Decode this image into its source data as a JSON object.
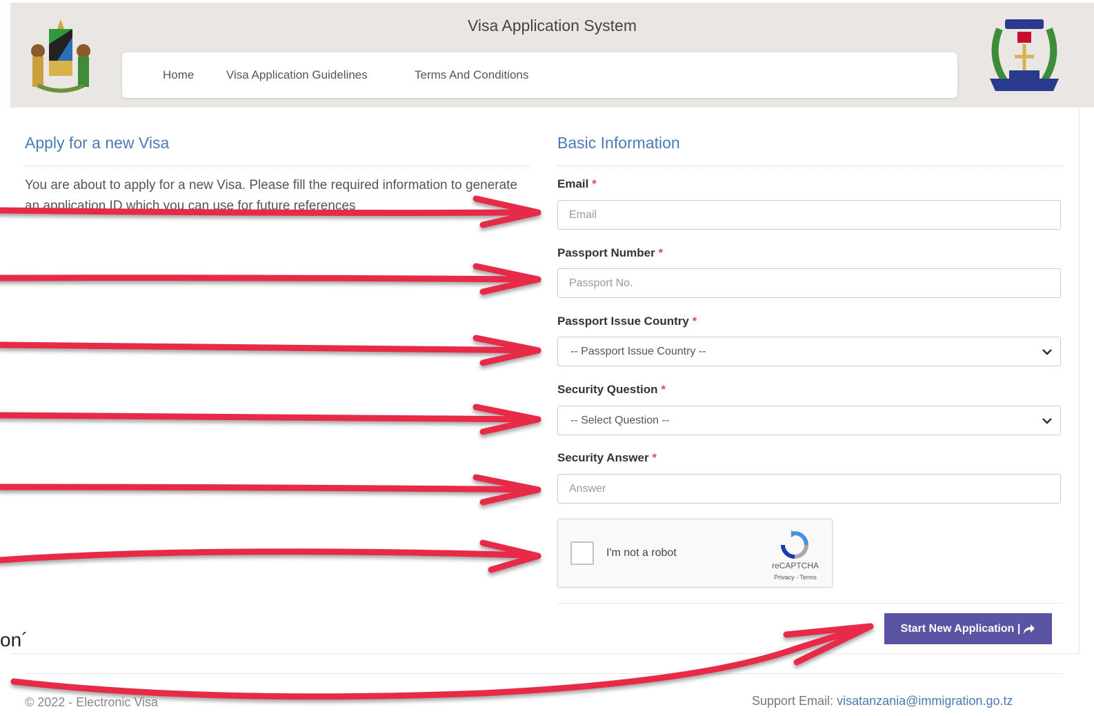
{
  "header": {
    "title": "Visa Application System",
    "nav": [
      "Home",
      "Visa Application Guidelines",
      "Terms And Conditions"
    ]
  },
  "left": {
    "title": "Apply for a new Visa",
    "intro": "You are about to apply for a new Visa. Please fill the required information to generate an application ID which you can use for future references"
  },
  "form": {
    "title": "Basic Information",
    "required_mark": "*",
    "email": {
      "label": "Email",
      "placeholder": "Email"
    },
    "passport": {
      "label": "Passport Number",
      "placeholder": "Passport No."
    },
    "country": {
      "label": "Passport Issue Country",
      "selected": "-- Passport Issue Country --"
    },
    "question": {
      "label": "Security Question",
      "selected": "-- Select Question --"
    },
    "answer": {
      "label": "Security Answer",
      "placeholder": "Answer"
    },
    "captcha": {
      "label": "I'm not a robot",
      "brand": "reCAPTCHA",
      "links": "Privacy - Terms"
    },
    "submit": "Start New Application |"
  },
  "footer": {
    "copyright": "© 2022 - Electronic Visa",
    "support_label": "Support Email:",
    "support_email": "visatanzania@immigration.go.tz"
  },
  "annotation": {
    "fragment": "on´"
  },
  "colors": {
    "accent": "#4a7ab3",
    "button": "#5a55a3",
    "arrow": "#e8294a",
    "header_bg": "#e9e6e4"
  }
}
